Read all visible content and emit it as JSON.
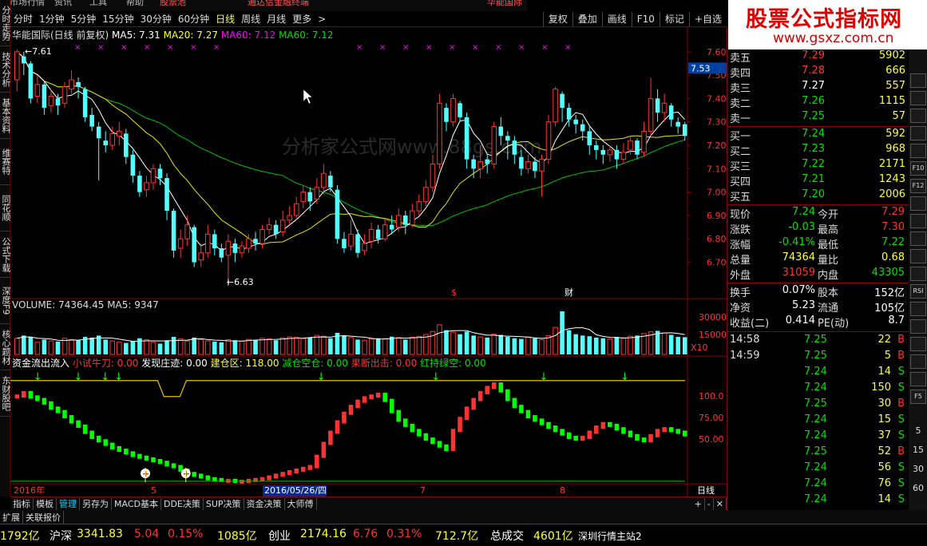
{
  "colors": {
    "up": "#ff3232",
    "down": "#54ffff",
    "text": "#c0c0c0",
    "yellow": "#ffff33",
    "green": "#00e000",
    "white": "#ffffff",
    "magenta": "#ff00ff",
    "frame": "#8b0000"
  },
  "menu": [
    "市场行情",
    "资讯",
    "工具",
    "帮助",
    "股票池",
    "通达信金融终端",
    "华能国际"
  ],
  "period_tabs": [
    "分时",
    "1分钟",
    "5分钟",
    "15分钟",
    "30分钟",
    "60分钟",
    "日线",
    "周线",
    "月线",
    "更多",
    ">"
  ],
  "active_period": "日线",
  "tools": [
    "复权",
    "叠加",
    "画线",
    "F10",
    "标记",
    "+自选"
  ],
  "left_tabs": [
    "分时走势",
    "技术分析",
    "基本资料",
    "维赛特",
    "同花顺",
    "公式下载",
    "深度F9",
    "核心题材",
    "东财股吧"
  ],
  "watermark": {
    "title": "股票公式指标网",
    "url": "www.gsxz.com.cn"
  },
  "main_header": {
    "name": "华能国际(日线 前复权)",
    "ma5": "MA5: 7.31",
    "ma20": "MA20: 7.27",
    "ma60a": "MA60: 7.12",
    "ma60b": "MA60: 7.12"
  },
  "center_watermark": "分析家公式网www.88gs.com",
  "price_axis": [
    "7.60",
    "7.50",
    "7.40",
    "7.30",
    "7.20",
    "7.10",
    "7.00",
    "6.90",
    "6.80",
    "6.70"
  ],
  "current_price_tag": "7.53",
  "high_label": "7.61",
  "low_label": "6.63",
  "markers": [
    "$",
    "财"
  ],
  "volume_header": {
    "vol": "VOLUME: 74364.45",
    "ma5": "MA5: 9347"
  },
  "volume_axis": [
    "30000",
    "15000",
    "X10"
  ],
  "indicator_header": [
    {
      "text": "资金流出流入",
      "color": "#ffffff"
    },
    {
      "text": "小试牛刀: 0.00",
      "color": "#ff3232"
    },
    {
      "text": "发现庄迹: 0.00",
      "color": "#ffffff"
    },
    {
      "text": "建仓区: 118.00",
      "color": "#ffff33"
    },
    {
      "text": "减仓空仓: 0.00",
      "color": "#00e000"
    },
    {
      "text": "果断出击: 0.00",
      "color": "#ff3232"
    },
    {
      "text": "红持绿空: 0.00",
      "color": "#00e000"
    }
  ],
  "indicator_axis": [
    "100.0",
    "75.00",
    "50.00"
  ],
  "date_axis": {
    "year": "2016年",
    "m5": "5",
    "selected": "2016/05/26/四",
    "m7": "7",
    "m8": "8",
    "period": "日线"
  },
  "bottom_tabs": [
    "指标",
    "模板",
    "管理",
    "另存为",
    "MACD基本",
    "DDE决策",
    "SUP决策",
    "资金决策",
    "大师傅"
  ],
  "active_bottom_tab": "管理",
  "expand_tabs": [
    "扩展",
    "关联报价"
  ],
  "orderbook": {
    "header": "委比",
    "asks": [
      {
        "label": "卖五",
        "price": "7.29",
        "vol": "5902",
        "color": "#ff3232"
      },
      {
        "label": "卖四",
        "price": "7.28",
        "vol": "666",
        "color": "#ff3232"
      },
      {
        "label": "卖三",
        "price": "7.27",
        "vol": "557",
        "color": "#ffffff"
      },
      {
        "label": "卖二",
        "price": "7.26",
        "vol": "1115",
        "color": "#00e000"
      },
      {
        "label": "卖一",
        "price": "7.25",
        "vol": "57",
        "color": "#00e000"
      }
    ],
    "bids": [
      {
        "label": "买一",
        "price": "7.24",
        "vol": "592",
        "color": "#00e000"
      },
      {
        "label": "买二",
        "price": "7.23",
        "vol": "968",
        "color": "#00e000"
      },
      {
        "label": "买三",
        "price": "7.22",
        "vol": "2171",
        "color": "#00e000"
      },
      {
        "label": "买四",
        "price": "7.21",
        "vol": "1243",
        "color": "#00e000"
      },
      {
        "label": "买五",
        "price": "7.20",
        "vol": "2006",
        "color": "#00e000"
      }
    ]
  },
  "quote": [
    {
      "l1": "现价",
      "v1": "7.24",
      "c1": "#00e000",
      "l2": "今开",
      "v2": "7.29",
      "c2": "#ff3232"
    },
    {
      "l1": "涨跌",
      "v1": "-0.03",
      "c1": "#00e000",
      "l2": "最高",
      "v2": "7.30",
      "c2": "#ff3232"
    },
    {
      "l1": "涨幅",
      "v1": "-0.41%",
      "c1": "#00e000",
      "l2": "最低",
      "v2": "7.22",
      "c2": "#00e000"
    },
    {
      "l1": "总量",
      "v1": "74364",
      "c1": "#ffff33",
      "l2": "量比",
      "v2": "0.68",
      "c2": "#ffff33"
    },
    {
      "l1": "外盘",
      "v1": "31059",
      "c1": "#ff3232",
      "l2": "内盘",
      "v2": "43305",
      "c2": "#00e000"
    },
    {
      "l1": "换手",
      "v1": "0.07%",
      "c1": "#ffffff",
      "l2": "股本",
      "v2": "152亿",
      "c2": "#ffffff"
    },
    {
      "l1": "净资",
      "v1": "5.23",
      "c1": "#ffffff",
      "l2": "流通",
      "v2": "105亿",
      "c2": "#ffffff"
    },
    {
      "l1": "收益(二)",
      "v1": "0.414",
      "c1": "#ffffff",
      "l2": "PE(动)",
      "v2": "8.7",
      "c2": "#ffffff"
    }
  ],
  "ticks": [
    {
      "time": "14:58",
      "price": "7.25",
      "vol": "22",
      "side": "B"
    },
    {
      "time": "14:59",
      "price": "7.25",
      "vol": "5",
      "side": "B"
    },
    {
      "time": "",
      "price": "7.24",
      "vol": "14",
      "side": "S"
    },
    {
      "time": "",
      "price": "7.24",
      "vol": "150",
      "side": "S"
    },
    {
      "time": "",
      "price": "7.25",
      "vol": "30",
      "side": "B"
    },
    {
      "time": "",
      "price": "7.24",
      "vol": "15",
      "side": "S"
    },
    {
      "time": "",
      "price": "7.24",
      "vol": "37",
      "side": "S"
    },
    {
      "time": "",
      "price": "7.25",
      "vol": "52",
      "side": "B"
    },
    {
      "time": "",
      "price": "7.24",
      "vol": "56",
      "side": "S"
    },
    {
      "time": "",
      "price": "7.24",
      "vol": "76",
      "side": "S"
    },
    {
      "time": "",
      "price": "7.24",
      "vol": "14",
      "side": "S"
    },
    {
      "time": "15:00",
      "price": "7.24",
      "vol": "275",
      "side": "S"
    }
  ],
  "side_icons": [
    "5",
    "15",
    "30",
    "60"
  ],
  "right_bottom_tabs": [
    "笔",
    "价",
    "细",
    "日",
    "势",
    "联",
    "值",
    "筹"
  ],
  "statusbar": [
    {
      "text": "1792亿",
      "color": "#ffff33"
    },
    {
      "text": "沪深",
      "color": "#ffffff"
    },
    {
      "text": "3341.83",
      "color": "#ffff33"
    },
    {
      "text": "5.04",
      "color": "#ff3232"
    },
    {
      "text": "0.15%",
      "color": "#ff3232"
    },
    {
      "text": "1085亿",
      "color": "#ffff33"
    },
    {
      "text": "创业",
      "color": "#ffffff"
    },
    {
      "text": "2174.16",
      "color": "#ffff33"
    },
    {
      "text": "6.76",
      "color": "#ff3232"
    },
    {
      "text": "0.31%",
      "color": "#ff3232"
    },
    {
      "text": "712.7亿",
      "color": "#ffff33"
    },
    {
      "text": "总成交",
      "color": "#ffffff"
    },
    {
      "text": "4601亿",
      "color": "#ffff33"
    },
    {
      "text": "深圳行情主站2",
      "color": "#ffffff"
    }
  ],
  "chart_data": {
    "type": "candlestick",
    "ylim": [
      6.62,
      7.63
    ],
    "candles": [
      [
        7.48,
        7.6,
        7.61,
        7.43
      ],
      [
        7.58,
        7.55,
        7.6,
        7.5
      ],
      [
        7.55,
        7.4,
        7.56,
        7.38
      ],
      [
        7.41,
        7.46,
        7.5,
        7.38
      ],
      [
        7.46,
        7.36,
        7.47,
        7.33
      ],
      [
        7.37,
        7.41,
        7.44,
        7.34
      ],
      [
        7.4,
        7.37,
        7.42,
        7.33
      ],
      [
        7.38,
        7.45,
        7.47,
        7.36
      ],
      [
        7.44,
        7.48,
        7.52,
        7.42
      ],
      [
        7.47,
        7.45,
        7.49,
        7.4
      ],
      [
        7.44,
        7.32,
        7.45,
        7.3
      ],
      [
        7.33,
        7.28,
        7.36,
        7.26
      ],
      [
        7.28,
        7.23,
        7.3,
        7.05
      ],
      [
        7.22,
        7.2,
        7.26,
        7.17
      ],
      [
        7.2,
        7.25,
        7.28,
        7.18
      ],
      [
        7.24,
        7.26,
        7.3,
        7.2
      ],
      [
        7.25,
        7.15,
        7.27,
        7.12
      ],
      [
        7.16,
        7.07,
        7.18,
        7.04
      ],
      [
        7.07,
        7.0,
        7.09,
        6.98
      ],
      [
        7.01,
        7.04,
        7.07,
        6.98
      ],
      [
        7.04,
        7.1,
        7.12,
        7.01
      ],
      [
        7.1,
        7.06,
        7.12,
        7.03
      ],
      [
        7.06,
        6.92,
        7.08,
        6.88
      ],
      [
        6.92,
        6.75,
        6.93,
        6.72
      ],
      [
        6.76,
        6.8,
        6.84,
        6.72
      ],
      [
        6.8,
        6.86,
        6.9,
        6.77
      ],
      [
        6.85,
        6.7,
        6.86,
        6.68
      ],
      [
        6.71,
        6.74,
        6.78,
        6.68
      ],
      [
        6.74,
        6.82,
        6.86,
        6.72
      ],
      [
        6.82,
        6.76,
        6.84,
        6.73
      ],
      [
        6.76,
        6.72,
        6.78,
        6.7
      ],
      [
        6.73,
        6.79,
        6.82,
        6.63
      ],
      [
        6.78,
        6.74,
        6.8,
        6.7
      ],
      [
        6.74,
        6.77,
        6.79,
        6.72
      ],
      [
        6.76,
        6.8,
        6.82,
        6.74
      ],
      [
        6.8,
        6.78,
        6.83,
        6.75
      ],
      [
        6.78,
        6.84,
        6.86,
        6.76
      ],
      [
        6.84,
        6.86,
        6.89,
        6.82
      ],
      [
        6.86,
        6.82,
        6.88,
        6.8
      ],
      [
        6.83,
        6.88,
        6.92,
        6.81
      ],
      [
        6.88,
        6.9,
        6.94,
        6.86
      ],
      [
        6.9,
        6.95,
        6.98,
        6.88
      ],
      [
        6.96,
        7.0,
        7.03,
        6.93
      ],
      [
        7.0,
        6.96,
        7.02,
        6.92
      ],
      [
        6.97,
        7.02,
        7.06,
        6.95
      ],
      [
        7.02,
        7.08,
        7.12,
        6.99
      ],
      [
        7.07,
        7.02,
        7.09,
        7.0
      ],
      [
        7.01,
        6.8,
        7.03,
        6.78
      ],
      [
        6.8,
        6.76,
        6.83,
        6.74
      ],
      [
        6.77,
        6.82,
        6.88,
        6.75
      ],
      [
        6.82,
        6.74,
        6.84,
        6.72
      ],
      [
        6.75,
        6.78,
        6.82,
        6.73
      ],
      [
        6.79,
        6.84,
        6.87,
        6.76
      ],
      [
        6.84,
        6.8,
        6.86,
        6.78
      ],
      [
        6.8,
        6.86,
        6.89,
        6.79
      ],
      [
        6.86,
        6.84,
        6.9,
        6.82
      ],
      [
        6.85,
        6.9,
        6.93,
        6.83
      ],
      [
        6.9,
        6.86,
        6.92,
        6.82
      ],
      [
        6.86,
        6.92,
        6.95,
        6.85
      ],
      [
        6.92,
        6.96,
        6.99,
        6.9
      ],
      [
        6.96,
        7.02,
        7.05,
        6.94
      ],
      [
        7.02,
        7.12,
        7.16,
        7.0
      ],
      [
        7.12,
        7.38,
        7.42,
        7.1
      ],
      [
        7.36,
        7.3,
        7.38,
        7.26
      ],
      [
        7.3,
        7.4,
        7.42,
        7.28
      ],
      [
        7.38,
        7.32,
        7.39,
        7.3
      ],
      [
        7.32,
        7.14,
        7.34,
        7.1
      ],
      [
        7.14,
        7.1,
        7.16,
        7.06
      ],
      [
        7.1,
        7.13,
        7.2,
        7.06
      ],
      [
        7.14,
        7.12,
        7.16,
        7.08
      ],
      [
        7.12,
        7.28,
        7.3,
        7.1
      ],
      [
        7.28,
        7.24,
        7.32,
        7.2
      ],
      [
        7.24,
        7.22,
        7.26,
        7.14
      ],
      [
        7.22,
        7.16,
        7.24,
        7.12
      ],
      [
        7.15,
        7.1,
        7.18,
        7.07
      ],
      [
        7.1,
        7.13,
        7.16,
        7.08
      ],
      [
        7.13,
        7.09,
        7.15,
        7.06
      ],
      [
        7.09,
        7.14,
        7.16,
        6.98
      ],
      [
        7.14,
        7.3,
        7.33,
        7.12
      ],
      [
        7.3,
        7.44,
        7.45,
        7.28
      ],
      [
        7.42,
        7.36,
        7.43,
        7.3
      ],
      [
        7.36,
        7.31,
        7.38,
        7.28
      ],
      [
        7.31,
        7.29,
        7.33,
        7.25
      ],
      [
        7.29,
        7.26,
        7.31,
        7.22
      ],
      [
        7.26,
        7.2,
        7.28,
        7.16
      ],
      [
        7.2,
        7.18,
        7.22,
        7.14
      ],
      [
        7.18,
        7.16,
        7.2,
        7.12
      ],
      [
        7.16,
        7.18,
        7.2,
        7.13
      ],
      [
        7.18,
        7.14,
        7.2,
        7.1
      ],
      [
        7.14,
        7.17,
        7.21,
        7.12
      ],
      [
        7.18,
        7.22,
        7.24,
        7.16
      ],
      [
        7.22,
        7.16,
        7.23,
        7.14
      ],
      [
        7.17,
        7.26,
        7.3,
        7.15
      ],
      [
        7.26,
        7.4,
        7.49,
        7.24
      ],
      [
        7.4,
        7.34,
        7.44,
        7.3
      ],
      [
        7.34,
        7.38,
        7.42,
        7.3
      ],
      [
        7.37,
        7.31,
        7.38,
        7.28
      ],
      [
        7.3,
        7.28,
        7.32,
        7.25
      ],
      [
        7.29,
        7.24,
        7.3,
        7.22
      ]
    ],
    "volume_max": 32000,
    "volumes": [
      12000,
      14000,
      13000,
      9000,
      11000,
      10000,
      9500,
      12000,
      11000,
      10500,
      13000,
      12500,
      14000,
      11000,
      10000,
      9000,
      8500,
      10000,
      12000,
      11000,
      9000,
      8000,
      10500,
      13000,
      11500,
      10000,
      12500,
      11000,
      10000,
      9500,
      9000,
      11000,
      10500,
      9800,
      11200,
      10800,
      12000,
      11500,
      10500,
      12300,
      13000,
      12800,
      11800,
      12500,
      14200,
      13500,
      12000,
      16000,
      14000,
      12500,
      11000,
      10500,
      11500,
      12000,
      11800,
      13200,
      12500,
      11000,
      12800,
      13500,
      14800,
      17000,
      22000,
      18000,
      16500,
      15000,
      17000,
      14000,
      13000,
      12500,
      15000,
      14500,
      13000,
      12000,
      11500,
      13000,
      12000,
      11000,
      14000,
      20000,
      32000,
      18000,
      15000,
      14000,
      13500,
      12500,
      12000,
      11500,
      13000,
      12000,
      13500,
      14000,
      15500,
      16800,
      17500,
      16000,
      14500,
      13000,
      12800
    ],
    "indicator": {
      "ylim": [
        0,
        128
      ],
      "top_level": 118,
      "values": [
        100,
        104,
        99,
        96,
        92,
        86,
        82,
        76,
        70,
        65,
        58,
        52,
        48,
        44,
        40,
        37,
        34,
        31,
        29,
        27,
        25,
        23,
        20,
        18,
        14,
        10,
        8,
        6,
        4,
        3,
        2,
        2,
        1,
        1,
        2,
        3,
        4,
        6,
        8,
        10,
        12,
        14,
        16,
        18,
        30,
        45,
        58,
        70,
        80,
        88,
        94,
        98,
        100,
        102,
        95,
        82,
        72,
        66,
        60,
        55,
        50,
        46,
        42,
        38,
        60,
        74,
        86,
        96,
        104,
        110,
        114,
        106,
        96,
        88,
        82,
        76,
        72,
        68,
        64,
        60,
        56,
        52,
        50,
        52,
        58,
        64,
        68,
        66,
        62,
        58,
        54,
        50,
        48,
        54,
        60,
        62,
        60,
        58,
        55
      ],
      "down_arrows": [
        0.04,
        0.1,
        0.14,
        0.16,
        0.46,
        0.63,
        0.79,
        0.91
      ],
      "buy_marks": [
        0.2,
        0.26
      ],
      "band_start": 0.23
    }
  }
}
